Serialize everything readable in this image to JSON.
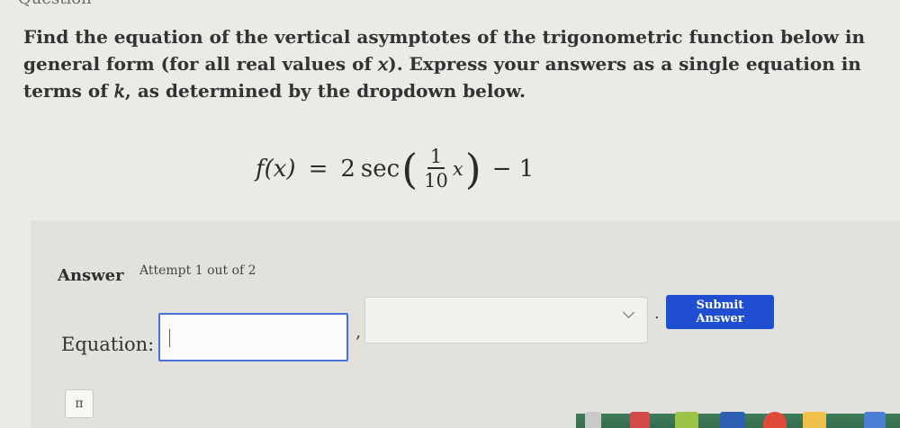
{
  "top_label": "Question",
  "question_text": "Find the equation of the vertical asymptotes of the trigonometric function below in general form (for all real values of 𝑥). Express your answers as a single equation in terms of 𝑘, as determined by the dropdown below.",
  "equation": {
    "lhs": "f(x)",
    "equals": "=",
    "coefficient": "2",
    "func": "sec",
    "numerator": "1",
    "denominator": "10",
    "variable": "x",
    "tail": "− 1"
  },
  "answer": {
    "label": "Answer",
    "attempt": "Attempt 1 out of 2",
    "equation_label": "Equation:",
    "equation_input_value": "",
    "comma": ",",
    "dropdown_value": "",
    "period": ".",
    "submit_label": "Submit Answer",
    "pi_label": "π"
  },
  "colors": {
    "accent": "#1f4fd0",
    "input_border": "#4a6fd6"
  }
}
